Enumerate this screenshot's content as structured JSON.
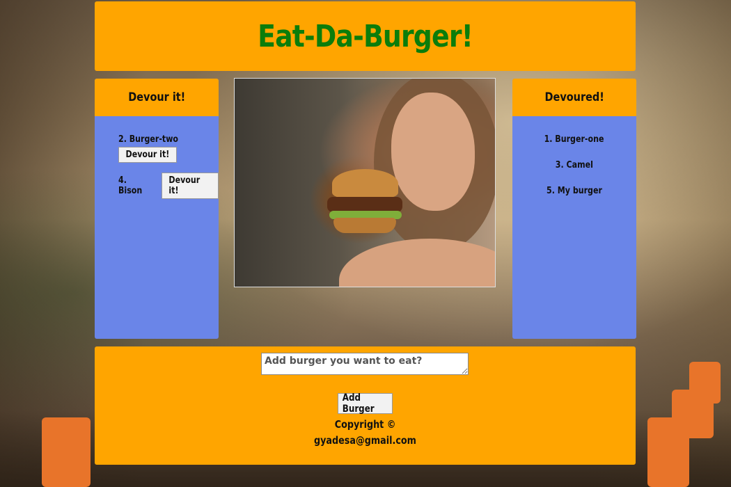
{
  "header": {
    "title": "Eat-Da-Burger!"
  },
  "devour_panel": {
    "title": "Devour it!",
    "items": [
      {
        "label": "2. Burger-two",
        "button": "Devour it!"
      },
      {
        "label": "4. Bison",
        "button": "Devour it!"
      }
    ]
  },
  "devoured_panel": {
    "title": "Devoured!",
    "items": [
      {
        "label": "1. Burger-one"
      },
      {
        "label": "3. Camel"
      },
      {
        "label": "5. My burger"
      }
    ]
  },
  "form": {
    "placeholder": "Add burger you want to eat?",
    "value": "",
    "submit_label": "Add Burger"
  },
  "footer": {
    "copyright": "Copyright ©",
    "email": "gyadesa@gmail.com"
  },
  "colors": {
    "header_bg": "#ffa500",
    "title_color": "#0b7d0b",
    "panel_bg": "#6a85e8"
  }
}
